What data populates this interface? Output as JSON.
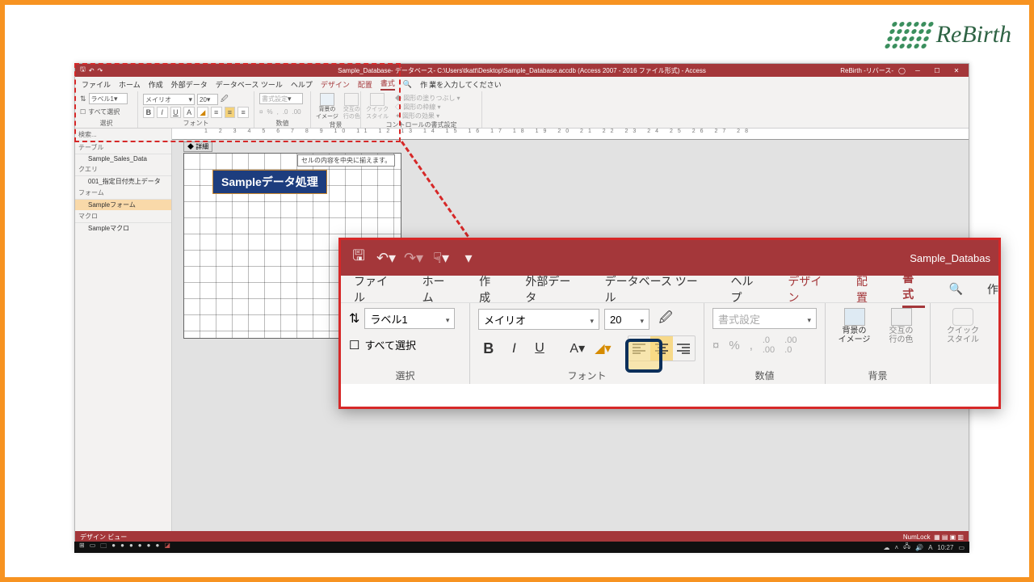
{
  "logo": {
    "text": "ReBirth"
  },
  "window": {
    "title_full": "Sample_Database- データベース- C:\\Users\\tkatt\\Desktop\\Sample_Database.accdb (Access 2007 - 2016 ファイル形式) - Access",
    "acct": "ReBirth -リバース-"
  },
  "menus": {
    "file": "ファイル",
    "home": "ホーム",
    "create": "作成",
    "external": "外部データ",
    "dbtools": "データベース ツール",
    "help": "ヘルプ",
    "design": "デザイン",
    "arrange": "配置",
    "format": "書式",
    "tell_prefix": "作",
    "tell_rest": "業を入力してください"
  },
  "ribbon": {
    "select_list": "ラベル1",
    "select_all": "すべて選択",
    "group_select": "選択",
    "font_name": "メイリオ",
    "font_size": "20",
    "group_font": "フォント",
    "num_format": "書式設定",
    "group_number": "数値",
    "bg_image": "背景の\nイメージ",
    "alt_row": "交互の\n行の色",
    "group_bg": "背景",
    "quick_style": "クイック\nスタイル",
    "shape_fill": "図形の塗りつぶし",
    "shape_outline": "図形の枠線",
    "shape_effects": "図形の効果",
    "group_ctrl": "コントロールの書式設定"
  },
  "tooltip": "セルの内容を中央に揃えます。",
  "nav": {
    "search": "検索...",
    "tables": "テーブル",
    "t1": "Sample_Sales_Data",
    "queries": "クエリ",
    "q1": "001_指定日付売上データ",
    "forms": "フォーム",
    "f1": "Sampleフォーム",
    "macros": "マクロ",
    "m1": "Sampleマクロ"
  },
  "form": {
    "section": "詳細",
    "label_text": "Sampleデータ処理"
  },
  "zoom": {
    "title_right": "Sample_Databas",
    "search_icon_alt": "検索"
  },
  "status": {
    "left": "デザイン ビュー",
    "numlock": "NumLock"
  },
  "taskbar": {
    "time": "10:27"
  }
}
